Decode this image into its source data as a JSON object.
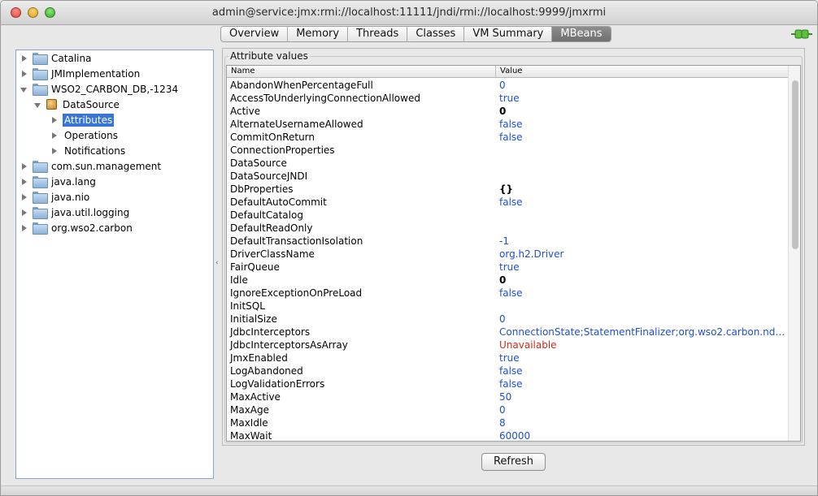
{
  "window": {
    "title": "admin@service:jmx:rmi://localhost:11111/jndi/rmi://localhost:9999/jmxrmi"
  },
  "tabs": [
    {
      "label": "Overview"
    },
    {
      "label": "Memory"
    },
    {
      "label": "Threads"
    },
    {
      "label": "Classes"
    },
    {
      "label": "VM Summary"
    },
    {
      "label": "MBeans",
      "active": true
    }
  ],
  "tree": {
    "nodes": [
      {
        "label": "Catalina",
        "level": 0,
        "icon": "folder-icon",
        "expander": "right"
      },
      {
        "label": "JMImplementation",
        "level": 0,
        "icon": "folder-icon",
        "expander": "right"
      },
      {
        "label": "WSO2_CARBON_DB,-1234",
        "level": 0,
        "icon": "folder-icon",
        "expander": "down"
      },
      {
        "label": "DataSource",
        "level": 1,
        "icon": "mbean-icon",
        "expander": "down"
      },
      {
        "label": "Attributes",
        "level": 2,
        "icon": "",
        "expander": "right",
        "selected": true
      },
      {
        "label": "Operations",
        "level": 2,
        "icon": "",
        "expander": "right"
      },
      {
        "label": "Notifications",
        "level": 2,
        "icon": "",
        "expander": "right"
      },
      {
        "label": "com.sun.management",
        "level": 0,
        "icon": "folder-icon",
        "expander": "right"
      },
      {
        "label": "java.lang",
        "level": 0,
        "icon": "folder-icon",
        "expander": "right"
      },
      {
        "label": "java.nio",
        "level": 0,
        "icon": "folder-icon",
        "expander": "right"
      },
      {
        "label": "java.util.logging",
        "level": 0,
        "icon": "folder-icon",
        "expander": "right"
      },
      {
        "label": "org.wso2.carbon",
        "level": 0,
        "icon": "folder-icon",
        "expander": "right"
      }
    ]
  },
  "attributes": {
    "group_label": "Attribute values",
    "columns": {
      "name": "Name",
      "value": "Value"
    },
    "rows": [
      {
        "name": "AbandonWhenPercentageFull",
        "value": "0",
        "style": "blue"
      },
      {
        "name": "AccessToUnderlyingConnectionAllowed",
        "value": "true",
        "style": "blue"
      },
      {
        "name": "Active",
        "value": "0",
        "style": "black"
      },
      {
        "name": "AlternateUsernameAllowed",
        "value": "false",
        "style": "blue"
      },
      {
        "name": "CommitOnReturn",
        "value": "false",
        "style": "blue"
      },
      {
        "name": "ConnectionProperties",
        "value": "",
        "style": "blue"
      },
      {
        "name": "DataSource",
        "value": "",
        "style": "blue"
      },
      {
        "name": "DataSourceJNDI",
        "value": "",
        "style": "blue"
      },
      {
        "name": "DbProperties",
        "value": "{}",
        "style": "black"
      },
      {
        "name": "DefaultAutoCommit",
        "value": "false",
        "style": "blue"
      },
      {
        "name": "DefaultCatalog",
        "value": "",
        "style": "blue"
      },
      {
        "name": "DefaultReadOnly",
        "value": "",
        "style": "blue"
      },
      {
        "name": "DefaultTransactionIsolation",
        "value": "-1",
        "style": "blue"
      },
      {
        "name": "DriverClassName",
        "value": "org.h2.Driver",
        "style": "blue"
      },
      {
        "name": "FairQueue",
        "value": "true",
        "style": "blue"
      },
      {
        "name": "Idle",
        "value": "0",
        "style": "black"
      },
      {
        "name": "IgnoreExceptionOnPreLoad",
        "value": "false",
        "style": "blue"
      },
      {
        "name": "InitSQL",
        "value": "",
        "style": "blue"
      },
      {
        "name": "InitialSize",
        "value": "0",
        "style": "blue"
      },
      {
        "name": "JdbcInterceptors",
        "value": "ConnectionState;StatementFinalizer;org.wso2.carbon.ndata…",
        "style": "blue"
      },
      {
        "name": "JdbcInterceptorsAsArray",
        "value": "Unavailable",
        "style": "red"
      },
      {
        "name": "JmxEnabled",
        "value": "true",
        "style": "blue"
      },
      {
        "name": "LogAbandoned",
        "value": "false",
        "style": "blue"
      },
      {
        "name": "LogValidationErrors",
        "value": "false",
        "style": "blue"
      },
      {
        "name": "MaxActive",
        "value": "50",
        "style": "blue"
      },
      {
        "name": "MaxAge",
        "value": "0",
        "style": "blue"
      },
      {
        "name": "MaxIdle",
        "value": "8",
        "style": "blue"
      },
      {
        "name": "MaxWait",
        "value": "60000",
        "style": "blue"
      }
    ]
  },
  "buttons": {
    "refresh": "Refresh"
  },
  "colors": {
    "selection": "#3875d7",
    "value_blue": "#1f4fcf",
    "value_red": "#d12a1a",
    "active_tab": "#7a7a7a"
  }
}
